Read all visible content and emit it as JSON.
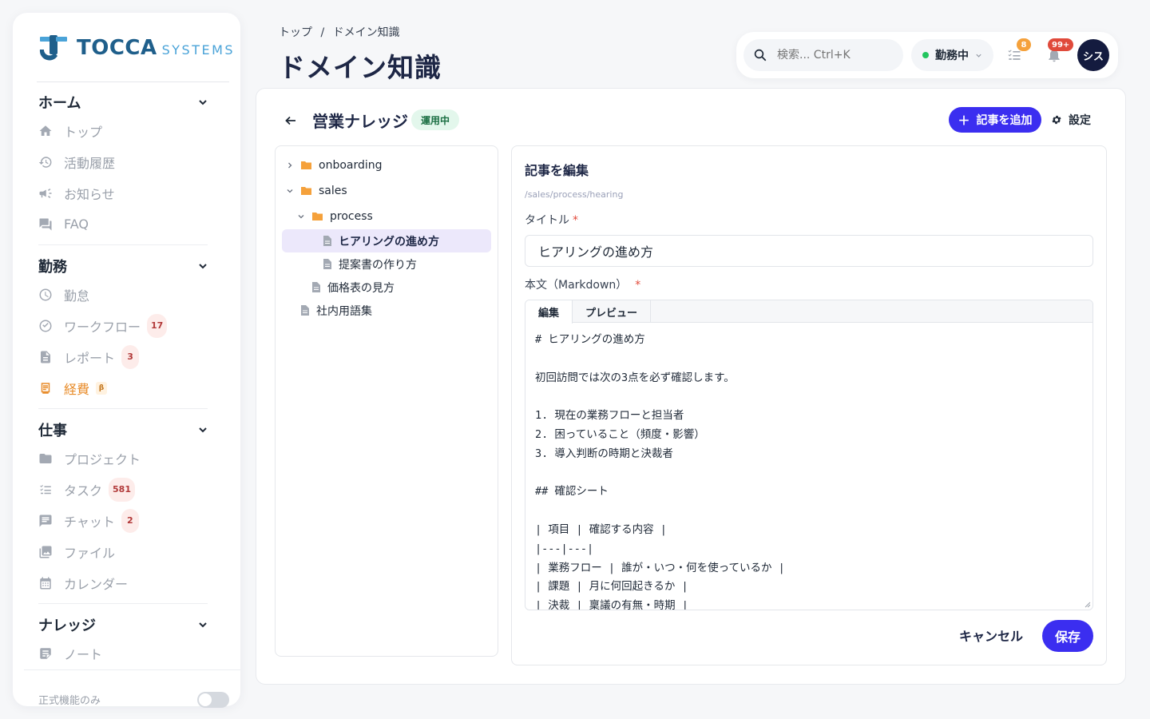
{
  "brand": {
    "name": "TOCCA",
    "suffix": "SYSTEMS",
    "colors": {
      "primary": "#1f5f8b",
      "accent": "#4aa3d8"
    }
  },
  "sidebar": {
    "sections": [
      {
        "label": "ホーム",
        "items": [
          {
            "label": "トップ",
            "icon": "home-icon"
          },
          {
            "label": "活動履歴",
            "icon": "history-icon"
          },
          {
            "label": "お知らせ",
            "icon": "megaphone-icon"
          },
          {
            "label": "FAQ",
            "icon": "chat-bubble-icon"
          }
        ]
      },
      {
        "label": "勤務",
        "items": [
          {
            "label": "勤怠",
            "icon": "clock-icon"
          },
          {
            "label": "ワークフロー",
            "icon": "check-circle-icon",
            "badge": "17"
          },
          {
            "label": "レポート",
            "icon": "document-icon",
            "badge": "3"
          },
          {
            "label": "経費",
            "icon": "receipt-icon",
            "badge": "β",
            "active": true
          }
        ]
      },
      {
        "label": "仕事",
        "items": [
          {
            "label": "プロジェクト",
            "icon": "folder-icon"
          },
          {
            "label": "タスク",
            "icon": "checklist-icon",
            "badge": "581"
          },
          {
            "label": "チャット",
            "icon": "message-icon",
            "badge": "2"
          },
          {
            "label": "ファイル",
            "icon": "image-icon"
          },
          {
            "label": "カレンダー",
            "icon": "calendar-icon"
          }
        ]
      },
      {
        "label": "ナレッジ",
        "items": [
          {
            "label": "ノート",
            "icon": "note-icon"
          }
        ]
      }
    ],
    "footer_label": "正式機能のみ"
  },
  "header": {
    "breadcrumb": [
      "トップ",
      "/",
      "ドメイン知識"
    ],
    "title": "ドメイン知識",
    "search_placeholder": "検索... Ctrl+K",
    "status_label": "勤務中",
    "tasks_badge": "8",
    "notifications_badge": "99+",
    "avatar_label": "シス"
  },
  "knowledge": {
    "title": "営業ナレッジ",
    "status_badge": "運用中",
    "add_button": "記事を追加",
    "settings_button": "設定"
  },
  "tree": [
    {
      "label": "onboarding",
      "type": "folder",
      "level": 0,
      "expanded": false
    },
    {
      "label": "sales",
      "type": "folder",
      "level": 0,
      "expanded": true
    },
    {
      "label": "process",
      "type": "folder",
      "level": 1,
      "expanded": true
    },
    {
      "label": "ヒアリングの進め方",
      "type": "doc",
      "level": 2,
      "selected": true
    },
    {
      "label": "提案書の作り方",
      "type": "doc",
      "level": 2
    },
    {
      "label": "価格表の見方",
      "type": "doc",
      "level": 1
    },
    {
      "label": "社内用語集",
      "type": "doc",
      "level": 0
    }
  ],
  "editor": {
    "heading": "記事を編集",
    "path": "/sales/process/hearing",
    "title_label": "タイトル",
    "title_value": "ヒアリングの進め方",
    "body_label": "本文（Markdown）",
    "tabs": [
      "編集",
      "プレビュー"
    ],
    "body_lines": [
      "# ヒアリングの進め方",
      "",
      "初回訪問では次の3点を必ず確認します。",
      "",
      "1. 現在の業務フローと担当者",
      "2. 困っていること（頻度・影響）",
      "3. 導入判断の時期と決裁者",
      "",
      "## 確認シート",
      "",
      "| 項目 | 確認する内容 |",
      "|---|---|",
      "| 業務フロー | 誰が・いつ・何を使っているか |",
      "| 課題 | 月に何回起きるか |",
      "| 決裁 | 稟議の有無・時期 |"
    ],
    "cancel_button": "キャンセル",
    "save_button": "保存"
  }
}
